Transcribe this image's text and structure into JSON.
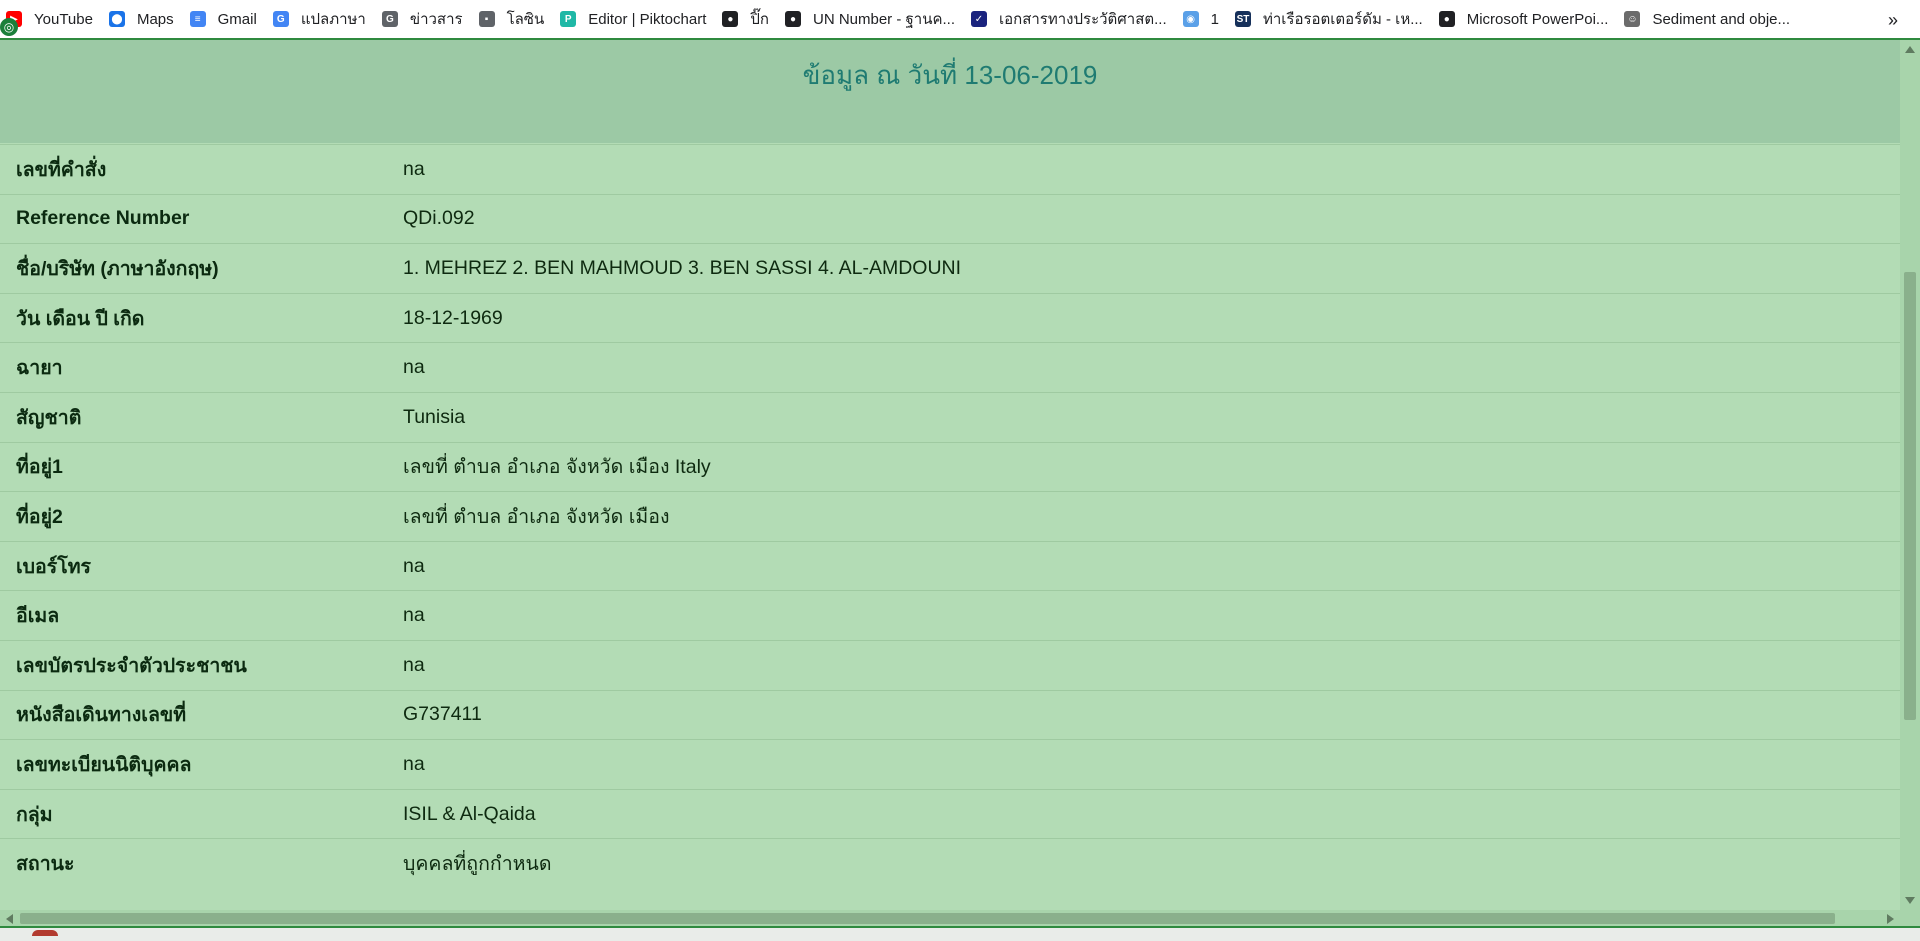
{
  "bookmarks": [
    {
      "label": "YouTube",
      "icon": "youtube-icon",
      "color": "#ff0000"
    },
    {
      "label": "Maps",
      "icon": "maps-pin-icon",
      "color": "#1a73e8"
    },
    {
      "label": "Gmail",
      "icon": "docs-icon",
      "color": "#4285f4"
    },
    {
      "label": "แปลภาษา",
      "icon": "translate-icon",
      "color": "#4285f4"
    },
    {
      "label": "ข่าวสาร",
      "icon": "news-icon",
      "color": "#5f6368"
    },
    {
      "label": "โลซิน",
      "icon": "logistics-icon",
      "color": "#5f6368"
    },
    {
      "label": "Editor | Piktochart",
      "icon": "piktochart-icon",
      "color": "#1fb8a6"
    },
    {
      "label": "ปิ๊ก",
      "icon": "globe-icon",
      "color": "#202124"
    },
    {
      "label": "UN Number - ฐานค...",
      "icon": "globe-icon",
      "color": "#202124"
    },
    {
      "label": "เอกสารทางประวัติศาสต...",
      "icon": "document-icon",
      "color": "#1a237e"
    },
    {
      "label": "1",
      "icon": "location-icon",
      "color": "#5aa0e8"
    },
    {
      "label": "ท่าเรือรอตเตอร์ดัม - เห...",
      "icon": "st-icon",
      "color": "#16305a"
    },
    {
      "label": "Microsoft PowerPoi...",
      "icon": "globe-icon",
      "color": "#202124"
    },
    {
      "label": "Sediment and obje...",
      "icon": "person-icon",
      "color": "#6b6b6b"
    }
  ],
  "bookmarks_more": "»",
  "header": {
    "date_line": "ข้อมูล ณ วันที่ 13-06-2019"
  },
  "rows": [
    {
      "label": "เลขที่คำสั่ง",
      "value": "na"
    },
    {
      "label": "Reference Number",
      "value": "QDi.092"
    },
    {
      "label": "ชื่อ/บริษัท (ภาษาอังกฤษ)",
      "value": "1. MEHREZ 2. BEN MAHMOUD 3. BEN SASSI 4. AL-AMDOUNI"
    },
    {
      "label": "วัน เดือน ปี เกิด",
      "value": "18-12-1969"
    },
    {
      "label": "ฉายา",
      "value": "na"
    },
    {
      "label": "สัญชาติ",
      "value": "Tunisia"
    },
    {
      "label": "ที่อยู่1",
      "value": "เลขที่ ตำบล อำเภอ จังหวัด เมือง Italy"
    },
    {
      "label": "ที่อยู่2",
      "value": "เลขที่ ตำบล อำเภอ จังหวัด เมือง"
    },
    {
      "label": "เบอร์โทร",
      "value": "na"
    },
    {
      "label": "อีเมล",
      "value": "na"
    },
    {
      "label": "เลขบัตรประจำตัวประชาชน",
      "value": "na"
    },
    {
      "label": "หนังสือเดินทางเลขที่",
      "value": "G737411"
    },
    {
      "label": "เลขทะเบียนนิติบุคคล",
      "value": "na"
    },
    {
      "label": "กลุ่ม",
      "value": "ISIL & Al-Qaida"
    },
    {
      "label": "สถานะ",
      "value": "บุคคลที่ถูกกำหนด"
    }
  ]
}
